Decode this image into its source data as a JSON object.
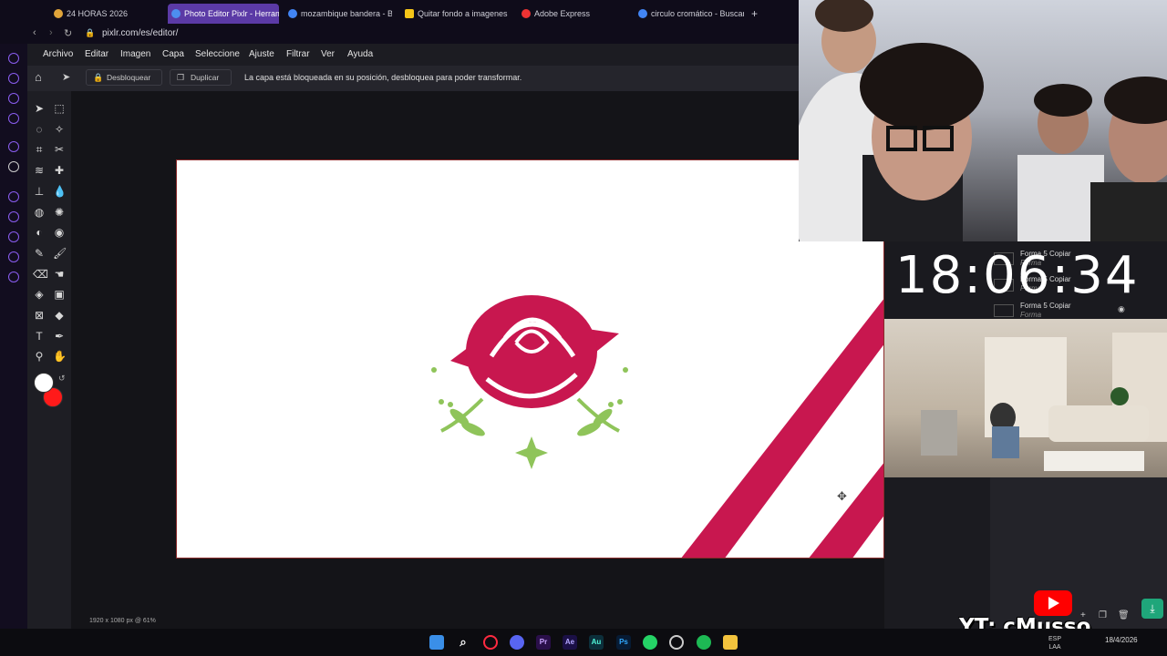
{
  "browser": {
    "tabs": [
      {
        "label": "24 HORAS 2026",
        "favicon_color": "#e0a43a"
      },
      {
        "label": "Photo Editor Pixlr - Herram",
        "favicon_color": "#4d8ef0",
        "active": true
      },
      {
        "label": "mozambique bandera - Bu",
        "favicon_color": "#4285f4"
      },
      {
        "label": "Quitar fondo a imagenes c",
        "favicon_color": "#f5c518"
      },
      {
        "label": "Adobe Express",
        "favicon_color": "#e33"
      },
      {
        "label": "circulo cromático - Buscar",
        "favicon_color": "#4285f4"
      }
    ],
    "new_tab": "+",
    "url": "pixlr.com/es/editor/"
  },
  "menu": [
    "Archivo",
    "Editar",
    "Imagen",
    "Capa",
    "Seleccione",
    "Ajuste",
    "Filtrar",
    "Ver",
    "Ayuda"
  ],
  "options": {
    "unlock_label": "Desbloquear",
    "duplicate_label": "Duplicar",
    "lock_message": "La capa está bloqueada en su posición, desbloquea para poder transformar."
  },
  "tools": [
    "move-icon",
    "marquee-icon",
    "lasso-icon",
    "wand-icon",
    "crop-icon",
    "cut-icon",
    "liquify-icon",
    "heal-icon",
    "stamp-icon",
    "drop-icon",
    "sphere-icon",
    "pattern-icon",
    "dodge-icon",
    "sponge-icon",
    "picker-icon",
    "brush-icon",
    "eraser-icon",
    "smudge-icon",
    "fill-icon",
    "gradient-icon",
    "transform-icon",
    "shape-icon",
    "text-icon",
    "pen-icon",
    "zoom-icon",
    "hand-icon"
  ],
  "colors": {
    "primary": "#ffffff",
    "secondary": "#ff1a1a",
    "accent": "#c8174f",
    "leaf": "#8fc45a"
  },
  "status": "1920 x 1080 px @ 61%",
  "clock": "18:06:34",
  "layers": [
    {
      "name": "Forma 5 Copiar",
      "type": "Forma"
    },
    {
      "name": "Forma 5 Copiar",
      "type": "Forma"
    },
    {
      "name": "Forma 5 Copiar",
      "type": "Forma"
    }
  ],
  "youtube_label": "YT: cMusso",
  "taskbar": {
    "date": "18/4/2026",
    "lang": "ESP LAA",
    "apps": [
      "Pr",
      "Ae",
      "Au",
      "Ps"
    ]
  }
}
